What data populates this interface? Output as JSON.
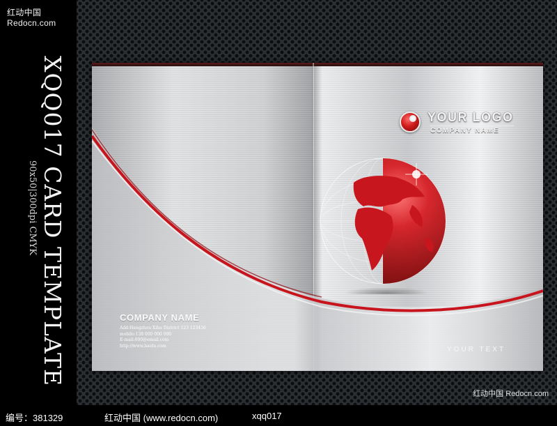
{
  "watermark": {
    "top_left": "红动中国 Redocn.com",
    "bottom_right": "红动中国 Redocn.com"
  },
  "sidebar": {
    "title": "XQQ017 CARD TEMPLATE",
    "subtitle": "90x50|300dpi CMYK"
  },
  "cover_right": {
    "logo_title": "YOUR LOGO",
    "logo_sub": "COMPANY NAME",
    "your_text": "YOUR TEXT"
  },
  "cover_left": {
    "company_name": "COMPANY NAME",
    "lines": [
      "Add:Hangzhou Xihu District 123 123456",
      "mobile:138 000 000 000",
      "E-mail:000@email.com",
      "http://www.baidu.com"
    ]
  },
  "footer": {
    "id_label": "编号：381329",
    "site_label": "红动中国 (www.redocn.com)",
    "code_label": "xqq017"
  },
  "colors": {
    "accent_red": "#c8141c",
    "silver": "#d8d9db",
    "background": "#2a2f33"
  }
}
